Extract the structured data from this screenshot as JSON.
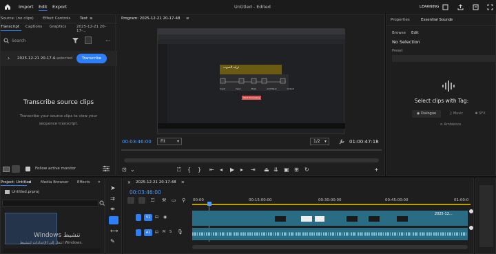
{
  "menu": {
    "home_icon": "home-icon",
    "items": [
      "Import",
      "Edit",
      "Export"
    ],
    "active": "Edit"
  },
  "title": "Untitled - Edited",
  "workspace": "LEARNING",
  "source_panel": {
    "tabs": [
      "Source: (no clips)",
      "Effect Controls",
      "Text"
    ],
    "subtabs": [
      "Transcript",
      "Captions",
      "Graphics",
      "2025-12-21 20-17-..."
    ],
    "search_placeholder": "Search",
    "clip_name": "2025-12-21 20-17-4...",
    "selected": "1 selected",
    "transcribe_button": "Transcribe",
    "heading": "Transcribe source clips",
    "description_line1": "Transcribe your source clips to view your",
    "description_line2": "sequence transcript.",
    "follow_label": "Follow active monitor"
  },
  "program": {
    "title": "Program: 2025-12-21 20-17-48",
    "timecode": "00:03:46:00",
    "fit": "Fit",
    "scale": "1/2",
    "duration": "01:00:47:18"
  },
  "essential": {
    "tabs": [
      "Properties",
      "Essential Sound"
    ],
    "subtabs": [
      "Browse",
      "Edit"
    ],
    "no_selection": "No Selection",
    "preset": "Preset",
    "select_heading": "Select clips with Tag:",
    "tags": [
      "Dialogue",
      "Music",
      "SFX",
      "Ambience"
    ]
  },
  "project": {
    "tabs": [
      "Project: Untitled",
      "Media Browser",
      "Effects"
    ],
    "file": "Untitled.prproj"
  },
  "timeline": {
    "sequence": "2025-12-21 20-17-48",
    "timecode": "00:03:46:00",
    "ruler": [
      "00:00",
      "00:15:00:00",
      "00:30:00:00",
      "00:45:00:00",
      "01:00:0"
    ],
    "tracks": [
      "V1",
      "A1"
    ],
    "clip_label": "2025-12..."
  },
  "screen_inner": {
    "dialog_title": "ترايد الصوت",
    "nodes": [
      "Input",
      "Input",
      "Mask",
      "Add Mask",
      "Output"
    ],
    "button": "Start Processing"
  },
  "watermark": {
    "line1": "Windows تنشيط",
    "line2": "انتقل إلى الإعدادات لتنشيط Windows."
  },
  "colors": {
    "accent": "#2d7ff9",
    "timecode": "#4a9cff",
    "clip": "#2a6c83",
    "panel": "#1e1e1e"
  }
}
